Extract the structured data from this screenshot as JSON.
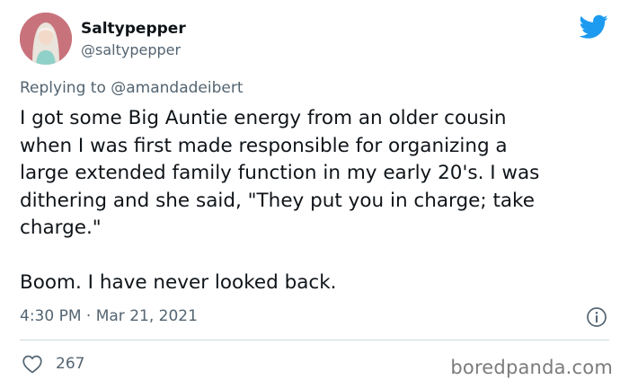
{
  "user": {
    "display_name": "Saltypepper",
    "handle": "@saltypepper"
  },
  "reply": {
    "prefix": "Replying to ",
    "mention": "@amandadeibert"
  },
  "tweet": {
    "text": "I got some Big Auntie energy from an older cousin\nwhen I was first made responsible for organizing a\nlarge extended family function in my early 20's. I was\ndithering and she said, \"They put you in charge; take\ncharge.\"\n\nBoom. I have never looked back.",
    "timestamp": "4:30 PM · Mar 21, 2021"
  },
  "engagement": {
    "likes": "267"
  },
  "watermark": "boredpanda.com",
  "colors": {
    "twitter_blue": "#1d9bf0",
    "secondary_text": "#536471",
    "divider": "#cfd9de"
  },
  "icons": [
    "twitter-bird-icon",
    "info-icon",
    "heart-icon"
  ]
}
